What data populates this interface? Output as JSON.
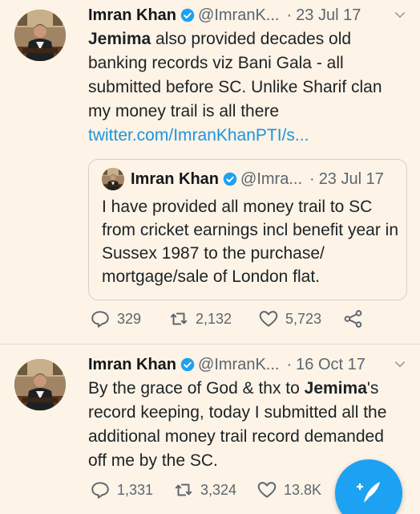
{
  "tweets": [
    {
      "name": "Imran Khan",
      "handle": "@ImranK...",
      "date": "23 Jul 17",
      "text_bold_start": "Jemima",
      "text_rest": " also provided decades old banking records viz Bani Gala - all submitted before SC. Unlike Sharif clan my money trail is all there ",
      "link": "twitter.com/ImranKhanPTI/s...",
      "quote": {
        "name": "Imran Khan",
        "handle": "@Imra...",
        "date": "23 Jul 17",
        "text": "I have provided all money trail to SC from cricket earnings incl benefit year in Sussex 1987 to the purchase/ mortgage/sale of London flat."
      },
      "replies": "329",
      "retweets": "2,132",
      "likes": "5,723"
    },
    {
      "name": "Imran Khan",
      "handle": "@ImranK...",
      "date": "16 Oct 17",
      "text_start": "By the grace of God & thx to ",
      "text_bold": "Jemima",
      "text_rest": "'s record keeping, today I submitted all the additional money trail record demanded off me by the SC.",
      "replies": "1,331",
      "retweets": "3,324",
      "likes": "13.8K"
    }
  ],
  "icons": {
    "verified": "verified-badge-icon",
    "caret": "chevron-down-icon",
    "reply": "reply-icon",
    "retweet": "retweet-icon",
    "like": "heart-icon",
    "share": "share-icon",
    "compose": "compose-tweet-icon"
  },
  "colors": {
    "background": "#fdf3e6",
    "link": "#1b95e0",
    "verified": "#1da1f2",
    "fab": "#1da1f2"
  }
}
